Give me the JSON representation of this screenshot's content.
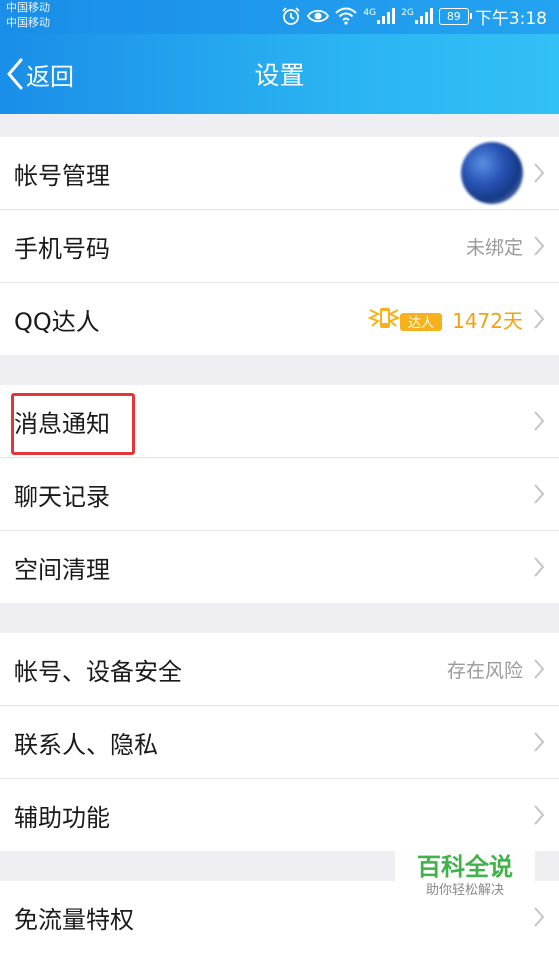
{
  "status_bar": {
    "carrier_1": "中国移动",
    "carrier_2": "中国移动",
    "network_1": "4G",
    "network_2": "2G",
    "battery": "89",
    "time": "下午3:18"
  },
  "nav": {
    "back_label": "返回",
    "title": "设置"
  },
  "group_1": [
    {
      "label": "帐号管理",
      "value": ""
    },
    {
      "label": "手机号码",
      "value": "未绑定"
    },
    {
      "label": "QQ达人",
      "value": "1472天",
      "badge": "达人"
    }
  ],
  "group_2": [
    {
      "label": "消息通知",
      "value": ""
    },
    {
      "label": "聊天记录",
      "value": ""
    },
    {
      "label": "空间清理",
      "value": ""
    }
  ],
  "group_3": [
    {
      "label": "帐号、设备安全",
      "value": "存在风险"
    },
    {
      "label": "联系人、隐私",
      "value": ""
    },
    {
      "label": "辅助功能",
      "value": ""
    }
  ],
  "group_4": [
    {
      "label": "免流量特权",
      "value": ""
    }
  ],
  "watermark": {
    "title": "百科全说",
    "subtitle": "助你轻松解决"
  },
  "colors": {
    "header_blue": "#1a8ee8",
    "highlight_red": "#e0383a",
    "daren_gold": "#f2a10f",
    "watermark_green": "#3fb24a"
  }
}
